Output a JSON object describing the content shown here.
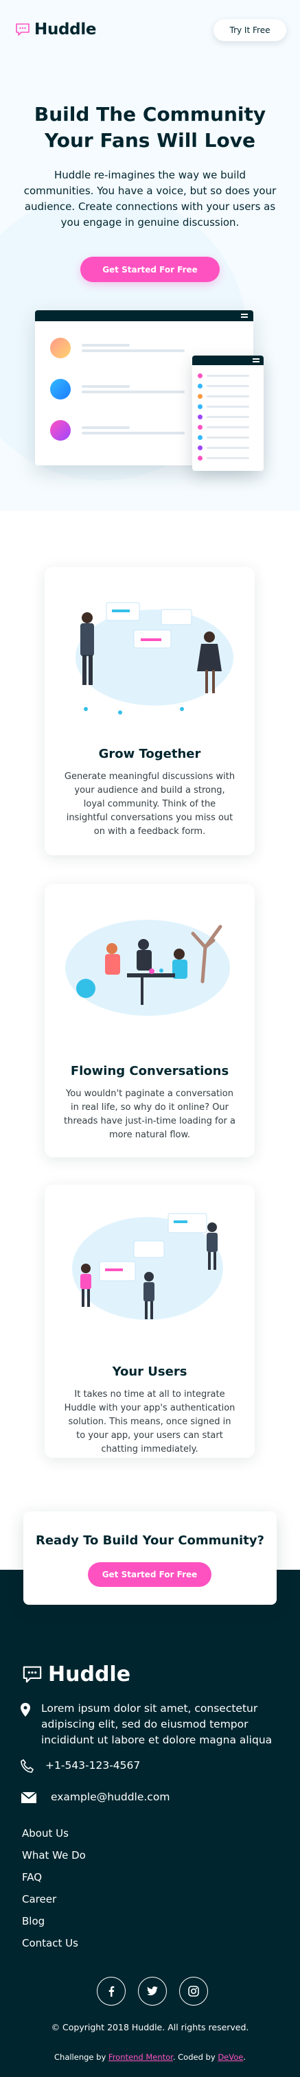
{
  "header": {
    "logo_text": "Huddle",
    "try_button": "Try It Free"
  },
  "hero": {
    "title": "Build The Community Your Fans Will Love",
    "description": "Huddle re-imagines the way we build communities. You have a voice, but so does your audience. Create connections with your users as you engage in genuine discussion.",
    "cta": "Get Started For Free"
  },
  "features": [
    {
      "title": "Grow Together",
      "description": "Generate meaningful discussions with your audience and build a strong, loyal community. Think of the insightful conversations you miss out on with a feedback form."
    },
    {
      "title": "Flowing Conversations",
      "description": "You wouldn't paginate a conversation in real life, so why do it online? Our threads have just-in-time loading for a more natural flow."
    },
    {
      "title": "Your Users",
      "description": "It takes no time at all to integrate Huddle with your app's authentication solution. This means, once signed in to your app, your users can start chatting immediately."
    }
  ],
  "ready": {
    "title": "Ready To Build Your Community?",
    "cta": "Get Started For Free"
  },
  "footer": {
    "logo_text": "Huddle",
    "address": "Lorem ipsum dolor sit amet, consectetur adipiscing elit, sed do eiusmod tempor incididunt ut labore et dolore magna aliqua",
    "phone": "+1-543-123-4567",
    "email": "example@huddle.com",
    "links": [
      "About Us",
      "What We Do",
      "FAQ",
      "Career",
      "Blog",
      "Contact Us"
    ],
    "social_icons": [
      "facebook-icon",
      "twitter-icon",
      "instagram-icon"
    ],
    "copyright": "© Copyright 2018 Huddle. All rights reserved.",
    "attribution_prefix": "Challenge by ",
    "attribution_link1": "Frontend Mentor",
    "attribution_middle": ". Coded by ",
    "attribution_link2": "DeVoe",
    "attribution_suffix": "."
  },
  "colors": {
    "accent_pink": "#ff52c1",
    "dark_cyan": "#00252e",
    "hero_bg": "#f5fbff"
  }
}
